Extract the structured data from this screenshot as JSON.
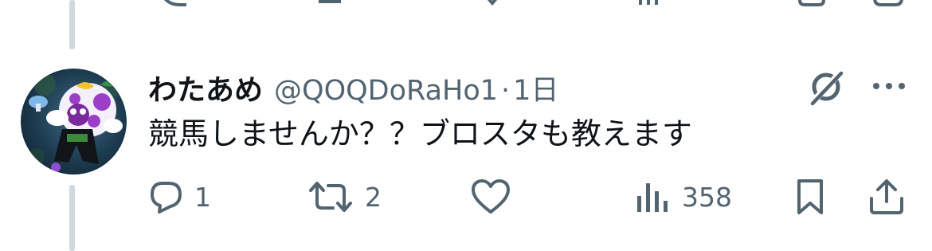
{
  "tweet": {
    "display_name": "わたあめ",
    "handle": "@QOQDoRaHo1",
    "separator": "·",
    "time": "1日",
    "text": "競馬しませんか？？ブロスタも教えます",
    "avatar_icon": "character-avatar"
  },
  "actions": {
    "reply": {
      "icon": "reply-icon",
      "count": "1"
    },
    "retweet": {
      "icon": "retweet-icon",
      "count": "2"
    },
    "like": {
      "icon": "heart-icon",
      "count": ""
    },
    "views": {
      "icon": "views-bar-chart-icon",
      "count": "358"
    },
    "bookmark": {
      "icon": "bookmark-icon"
    },
    "share": {
      "icon": "share-icon"
    }
  },
  "colors": {
    "text": "#0f1419",
    "muted": "#536471",
    "thread_line": "#cfd9de",
    "background": "#ffffff"
  }
}
